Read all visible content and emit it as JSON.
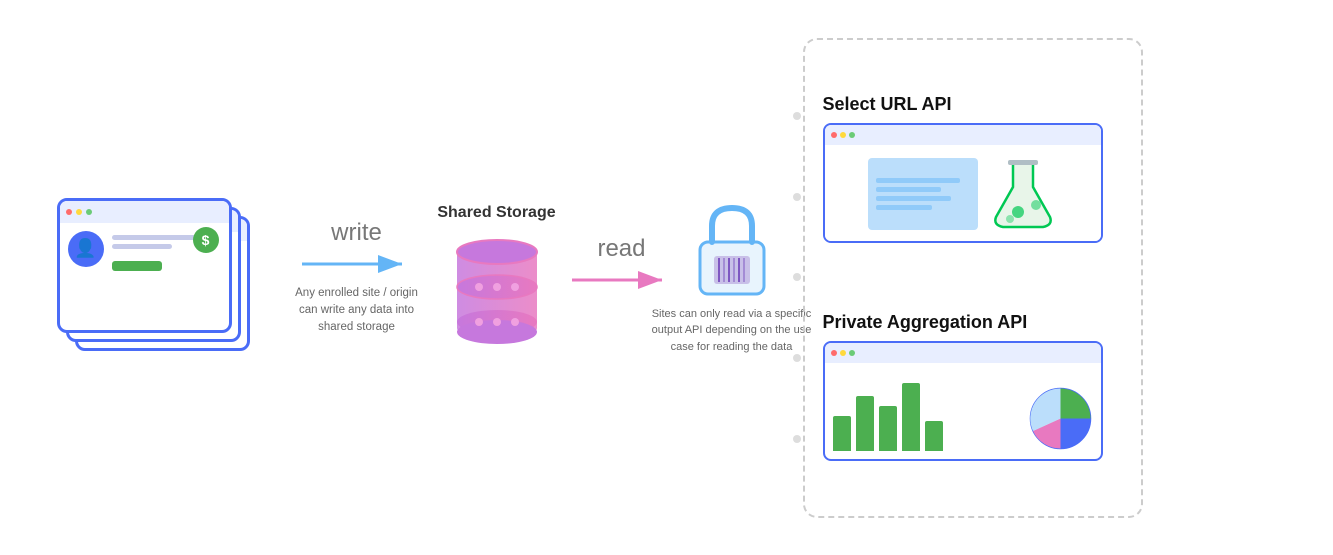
{
  "diagram": {
    "write_label": "write",
    "read_label": "read",
    "shared_storage_title": "Shared Storage",
    "write_caption": "Any enrolled site / origin can write any data into shared storage",
    "read_caption": "Sites can only read via a specific output API depending on the use case for reading the data",
    "apis": [
      {
        "id": "select-url",
        "title": "Select URL API"
      },
      {
        "id": "private-aggregation",
        "title": "Private Aggregation API"
      }
    ],
    "colors": {
      "blue": "#4a6cf7",
      "green": "#4caf50",
      "pink": "#e879c0",
      "light_blue": "#bbdefb",
      "arrow_blue": "#64b5f6",
      "arrow_pink": "#f48fb1"
    }
  }
}
